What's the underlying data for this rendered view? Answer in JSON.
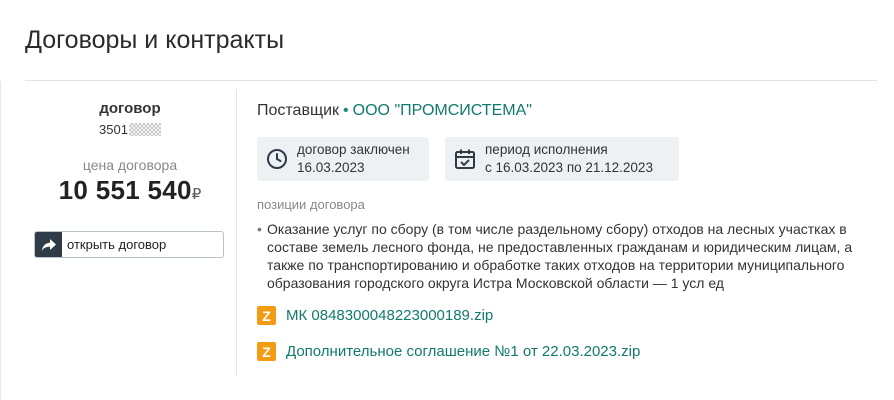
{
  "page": {
    "title": "Договоры и контракты"
  },
  "contract": {
    "type_label": "договор",
    "number_prefix": "3501",
    "price_label": "цена договора",
    "price_value": "10 551 540",
    "currency": "₽",
    "open_button_label": "открыть договор"
  },
  "supplier": {
    "label": "Поставщик",
    "separator": "•",
    "name": "ООО \"ПРОМСИСТЕМА\""
  },
  "status": {
    "signed_label": "договор заключен",
    "signed_date": "16.03.2023",
    "period_label": "период исполнения",
    "period_value": "с 16.03.2023 по 21.12.2023"
  },
  "positions": {
    "label": "позиции договора",
    "items": [
      {
        "bullet": "•",
        "text": "Оказание услуг по сбору (в том числе раздельному сбору) отходов на лесных участках в составе земель лесного фонда, не предоставленных гражданам и юридическим лицам, а также по транспортированию и обработке таких отходов на территории муниципального образования городского округа Истра Московской области — 1 усл ед"
      }
    ]
  },
  "files": [
    {
      "icon_letter": "Z",
      "icon": "zip-archive-icon",
      "name": "МК 0848300048223000189.zip"
    },
    {
      "icon_letter": "Z",
      "icon": "zip-archive-icon",
      "name": "Дополнительное соглашение №1 от 22.03.2023.zip"
    }
  ],
  "colors": {
    "link": "#117a6c",
    "zip_badge": "#f39b12",
    "button_icon_bg": "#2f3b47",
    "info_box_bg": "#eef1f4"
  }
}
